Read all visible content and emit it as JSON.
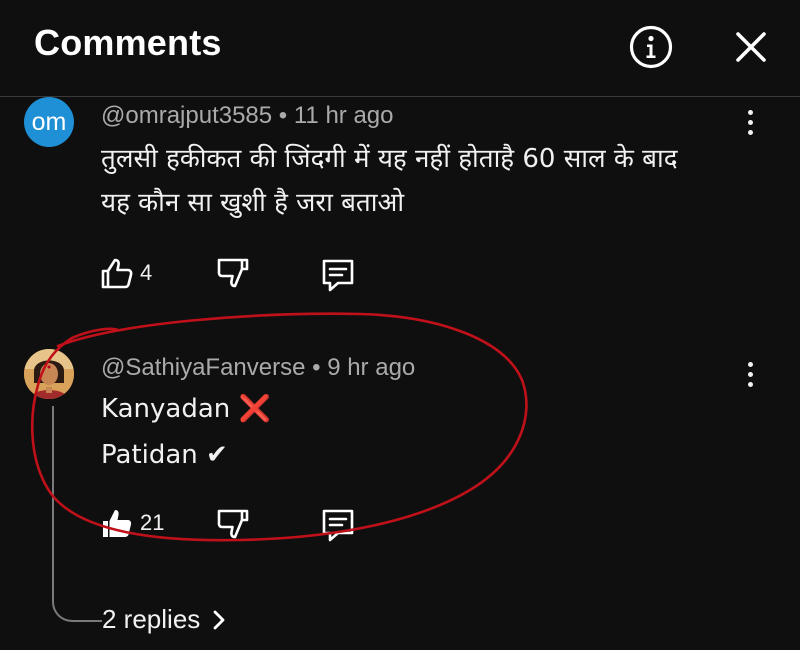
{
  "header": {
    "title": "Comments",
    "info_icon": "info-icon",
    "close_icon": "close-icon"
  },
  "comments": [
    {
      "avatar_text": "om",
      "avatar_color": "#1f8fd6",
      "meta": "@omrajput3585 • 11 hr ago",
      "lines": [
        "तुलसी हकीकत की जिंदगी में यह नहीं होताहै 60 साल के बाद",
        "यह कौन सा खुशी है जरा बताओ"
      ],
      "likes": "4"
    },
    {
      "meta": "@SathiyaFanverse • 9 hr ago",
      "lines": [
        "Kanyadan ❌",
        "Patidan ✔"
      ],
      "likes": "21",
      "replies_label": "2 replies"
    }
  ],
  "annotation_color": "#c0111a"
}
